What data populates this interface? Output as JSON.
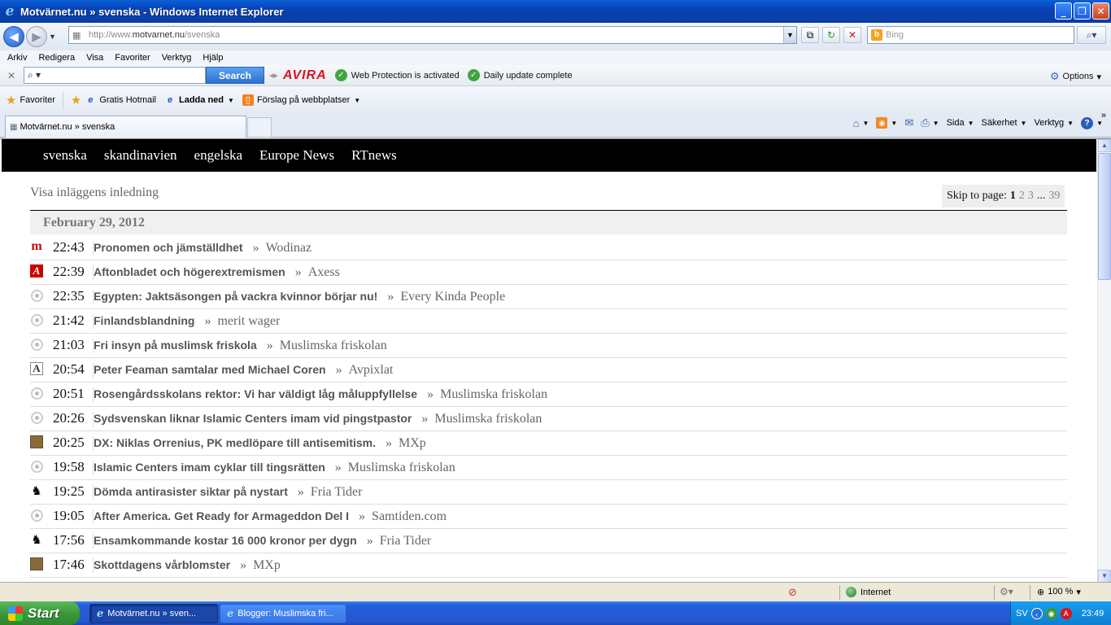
{
  "window": {
    "title": "Motvärnet.nu » svenska - Windows Internet Explorer",
    "min": "_",
    "max": "❐",
    "close": "✕"
  },
  "address": {
    "url_prefix": "http://www.",
    "url_domain": "motvarnet.nu",
    "url_path": "/svenska",
    "search_placeholder": "Bing"
  },
  "menu": [
    "Arkiv",
    "Redigera",
    "Visa",
    "Favoriter",
    "Verktyg",
    "Hjälp"
  ],
  "avira": {
    "search_label": "Search",
    "logo": "AVIRA",
    "status1": "Web Protection is activated",
    "status2": "Daily update complete",
    "options": "Options"
  },
  "favbar": {
    "favorites": "Favoriter",
    "item1": "Gratis Hotmail",
    "item2": "Ladda ned",
    "item3": "Förslag på webbplatser"
  },
  "tabs": {
    "active_title": "Motvärnet.nu » svenska"
  },
  "commandbar": {
    "page": "Sida",
    "safety": "Säkerhet",
    "tools": "Verktyg",
    "more": "»"
  },
  "site": {
    "nav": [
      "svenska",
      "skandinavien",
      "engelska",
      "Europe News",
      "RTnews"
    ],
    "visa": "Visa inläggens inledning",
    "skip_label": "Skip to page:",
    "skip_current": "1",
    "skip_pages": [
      "2",
      "3",
      "...",
      "39"
    ],
    "date": "February 29, 2012"
  },
  "posts": [
    {
      "icon": "m",
      "time": "22:43",
      "title": "Pronomen och jämställdhet",
      "source": "Wodinaz"
    },
    {
      "icon": "a",
      "time": "22:39",
      "title": "Aftonbladet och högerextremismen",
      "source": "Axess"
    },
    {
      "icon": "circ",
      "time": "22:35",
      "title": "Egypten: Jaktsäsongen på vackra kvinnor börjar nu!",
      "source": "Every Kinda People"
    },
    {
      "icon": "circ",
      "time": "21:42",
      "title": "Finlandsblandning",
      "source": "merit wager"
    },
    {
      "icon": "circ",
      "time": "21:03",
      "title": "Fri insyn på muslimsk friskola",
      "source": "Muslimska friskolan"
    },
    {
      "icon": "av",
      "time": "20:54",
      "title": "Peter Feaman samtalar med Michael Coren",
      "source": "Avpixlat"
    },
    {
      "icon": "circ",
      "time": "20:51",
      "title": "Rosengårdsskolans rektor: Vi har väldigt låg måluppfyllelse",
      "source": "Muslimska friskolan"
    },
    {
      "icon": "circ",
      "time": "20:26",
      "title": "Sydsvenskan liknar Islamic Centers imam vid pingstpastor",
      "source": "Muslimska friskolan"
    },
    {
      "icon": "mx",
      "time": "20:25",
      "title": "DX: Niklas Orrenius, PK medlöpare till antisemitism.",
      "source": "MXp"
    },
    {
      "icon": "circ",
      "time": "19:58",
      "title": "Islamic Centers imam cyklar till tingsrätten",
      "source": "Muslimska friskolan"
    },
    {
      "icon": "horse",
      "time": "19:25",
      "title": "Dömda antirasister siktar på nystart",
      "source": "Fria Tider"
    },
    {
      "icon": "circ",
      "time": "19:05",
      "title": "After America. Get Ready for Armageddon Del I",
      "source": "Samtiden.com"
    },
    {
      "icon": "horse",
      "time": "17:56",
      "title": "Ensamkommande kostar 16 000 kronor per dygn",
      "source": "Fria Tider"
    },
    {
      "icon": "mx",
      "time": "17:46",
      "title": "Skottdagens vårblomster",
      "source": "MXp"
    }
  ],
  "status": {
    "zone": "Internet",
    "zoom": "100 %"
  },
  "taskbar": {
    "start": "Start",
    "item1": "Motvärnet.nu » sven...",
    "item2": "Blogger: Muslimska fri...",
    "lang": "SV",
    "clock": "23:49"
  }
}
